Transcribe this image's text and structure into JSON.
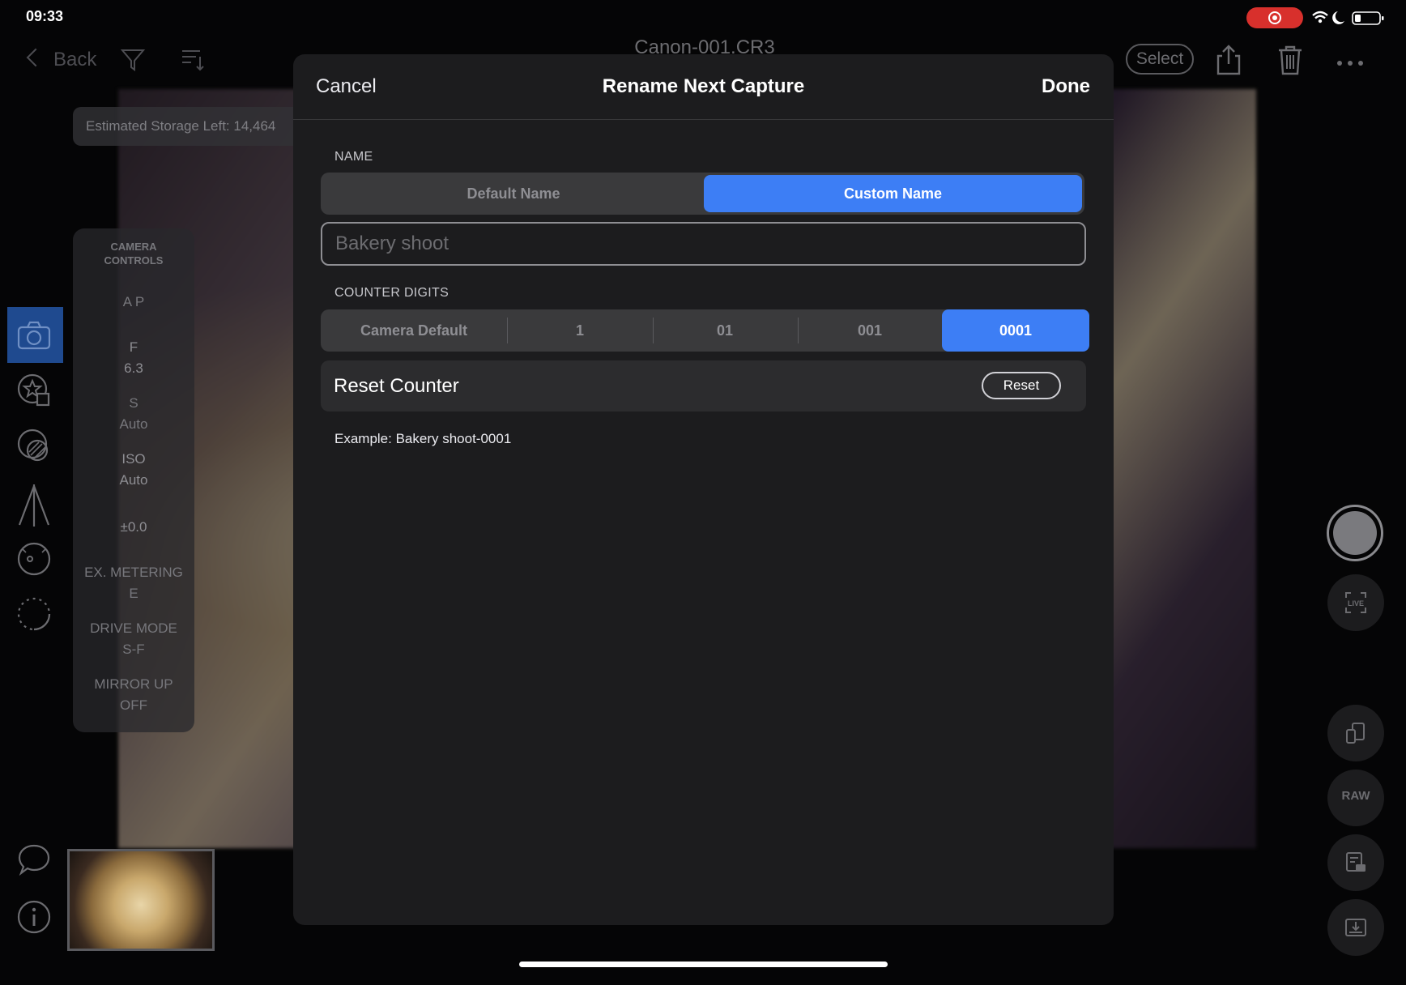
{
  "status_bar": {
    "time": "09:33"
  },
  "toolbar": {
    "back_label": "Back",
    "title": "Canon-001.CR3",
    "select_label": "Select"
  },
  "storage": {
    "text": "Estimated Storage Left: 14,464"
  },
  "camera_controls": {
    "heading": "CAMERA CONTROLS",
    "items": [
      {
        "label": "A P",
        "value": ""
      },
      {
        "label": "F",
        "value": "6.3"
      },
      {
        "label": "S",
        "value": "Auto"
      },
      {
        "label": "ISO",
        "value": "Auto"
      },
      {
        "label": "±0.0",
        "value": ""
      },
      {
        "label": "EX. METERING",
        "value": "E"
      },
      {
        "label": "DRIVE MODE",
        "value": "S-F"
      },
      {
        "label": "MIRROR UP",
        "value": "OFF"
      }
    ]
  },
  "right_rail": {
    "raw_label": "RAW"
  },
  "modal": {
    "cancel_label": "Cancel",
    "title": "Rename Next Capture",
    "done_label": "Done",
    "name_section_label": "NAME",
    "name_options": [
      "Default Name",
      "Custom Name"
    ],
    "name_selected": "Custom Name",
    "name_input_placeholder": "Bakery shoot",
    "counter_section_label": "COUNTER DIGITS",
    "counter_options": [
      "Camera Default",
      "1",
      "01",
      "001",
      "0001"
    ],
    "counter_selected": "0001",
    "reset_counter_label": "Reset Counter",
    "reset_button_label": "Reset",
    "example_text": "Example: Bakery shoot-0001"
  },
  "colors": {
    "accent": "#3d7ef5",
    "modal_bg": "#1c1c1e",
    "record_indicator": "#d8302c"
  }
}
